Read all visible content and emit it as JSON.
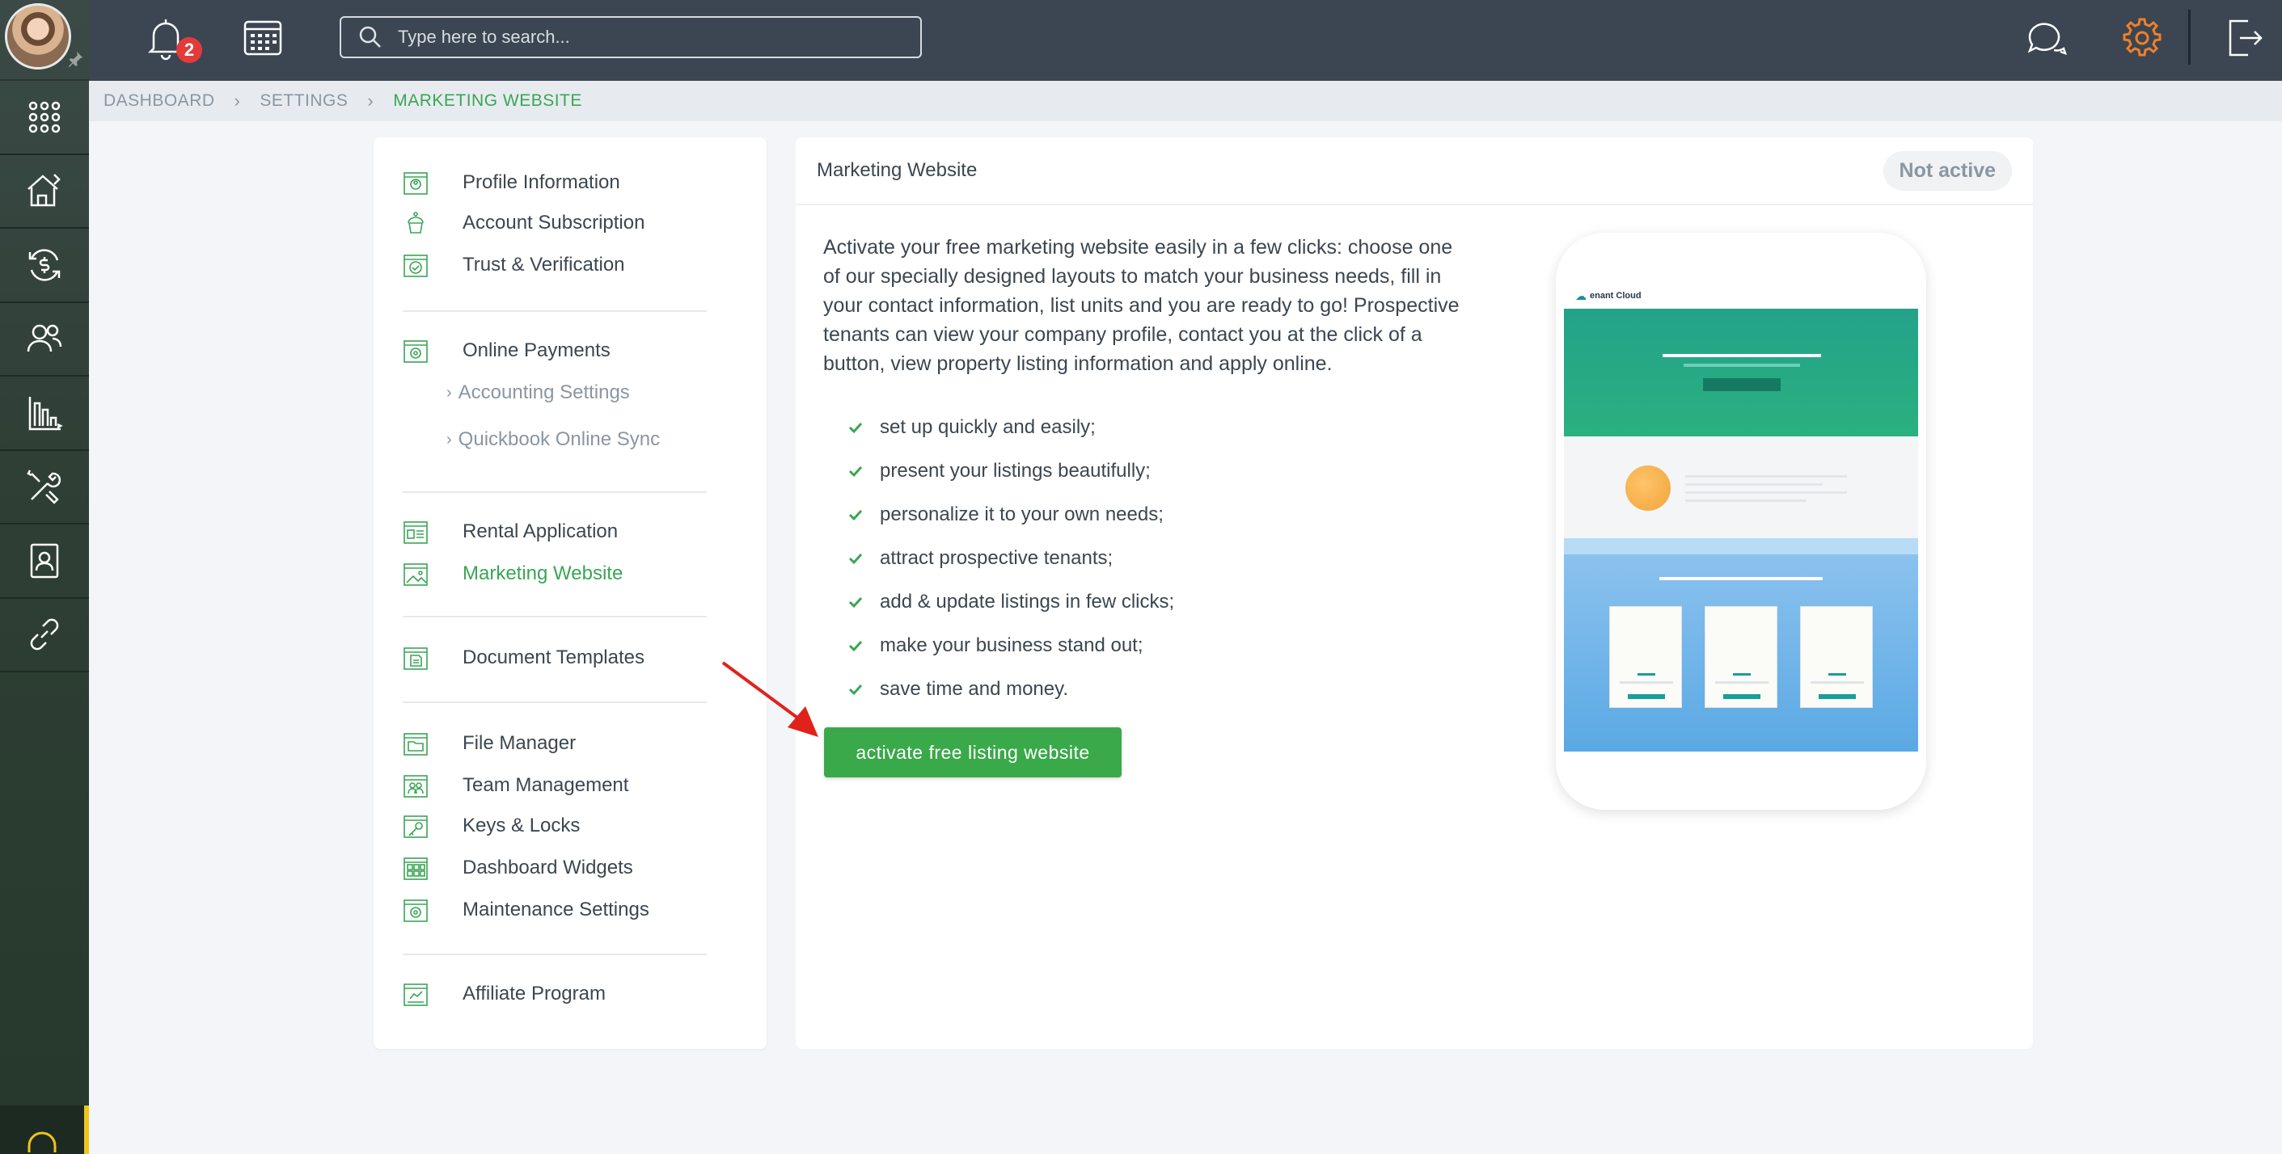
{
  "topbar": {
    "notifications_count": "2",
    "search_placeholder": "Type here to search..."
  },
  "breadcrumb": {
    "items": [
      "DASHBOARD",
      "SETTINGS",
      "MARKETING WEBSITE"
    ]
  },
  "settings_menu": {
    "groups": [
      [
        "Profile Information",
        "Account Subscription",
        "Trust & Verification"
      ],
      [
        "Online Payments",
        "Accounting Settings",
        "Quickbook Online Sync"
      ],
      [
        "Rental Application",
        "Marketing Website"
      ],
      [
        "Document Templates"
      ],
      [
        "File Manager",
        "Team Management",
        "Keys & Locks",
        "Dashboard Widgets",
        "Maintenance Settings"
      ],
      [
        "Affiliate Program"
      ]
    ],
    "active": "Marketing Website"
  },
  "main": {
    "title": "Marketing Website",
    "status": "Not active",
    "description": "Activate your free marketing website easily in a few clicks: choose one of our specially designed layouts to match your business needs, fill in your contact information, list units and you are ready to go! Prospective tenants can view your company profile, contact you at the click of a button, view property listing information and apply online.",
    "features": [
      "set up quickly and easily;",
      "present your listings beautifully;",
      "personalize it to your own needs;",
      "attract prospective tenants;",
      "add & update listings in few clicks;",
      "make your business stand out;",
      "save time and money."
    ],
    "activate_button": "activate free listing website",
    "preview_brand": "enant Cloud"
  },
  "colors": {
    "accent_green": "#3aa555",
    "topbar": "#3b4652",
    "gear_orange": "#f07f2a",
    "badge_red": "#e43a3a"
  }
}
